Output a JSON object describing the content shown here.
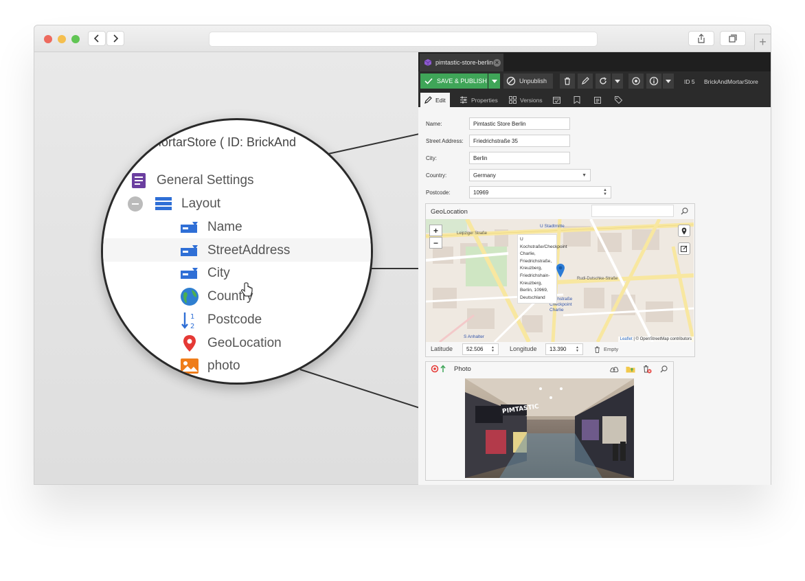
{
  "browser": {
    "title": ""
  },
  "magnifier": {
    "header": "dMortarStore ( ID: BrickAnd",
    "items": [
      {
        "label": "General Settings",
        "icon": "document-list-icon"
      },
      {
        "label": "Layout",
        "icon": "layout-panel-icon"
      },
      {
        "label": "Name",
        "icon": "input-field-icon"
      },
      {
        "label": "StreetAddress",
        "icon": "input-field-icon"
      },
      {
        "label": "City",
        "icon": "input-field-icon"
      },
      {
        "label": "Country",
        "icon": "globe-icon"
      },
      {
        "label": "Postcode",
        "icon": "number-sort-icon"
      },
      {
        "label": "GeoLocation",
        "icon": "map-pin-icon"
      },
      {
        "label": "photo",
        "icon": "image-icon"
      }
    ]
  },
  "pimcore": {
    "tab": {
      "label": "pimtastic-store-berlin"
    },
    "toolbar": {
      "save_label": "SAVE & PUBLISH",
      "unpublish_label": "Unpublish",
      "id_label": "ID 5",
      "class_label": "BrickAndMortarStore"
    },
    "subtabs": {
      "edit": "Edit",
      "properties": "Properties",
      "versions": "Versions"
    },
    "form": {
      "name_label": "Name:",
      "name_value": "Pimtastic Store Berlin",
      "street_label": "Street Address:",
      "street_value": "Friedrichstraße 35",
      "city_label": "City:",
      "city_value": "Berlin",
      "country_label": "Country:",
      "country_value": "Germany",
      "postcode_label": "Postcode:",
      "postcode_value": "10969"
    },
    "geo": {
      "title": "GeoLocation",
      "tooltip": "U Kochstraße/Checkpoint Charlie, Friedrichstraße, Kreuzberg, Friedrichshain-Kreuzberg, Berlin, 10969, Deutschland",
      "attribution_leaflet": "Leaflet",
      "attribution_rest": "| © OpenStreetMap contributors",
      "latitude_label": "Latitude",
      "latitude_value": "52.506",
      "longitude_label": "Longitude",
      "longitude_value": "13.390",
      "empty_label": "Empty",
      "map_labels": {
        "u_stadtmitte": "U Stadtmitte",
        "leipziger": "Leipziger Straße",
        "rudi_dutschke": "Rudi-Dutschke-Straße",
        "kochstrasse": "Kochstraße Checkpoint Charlie",
        "anhalter": "S Anhalter"
      }
    },
    "photo": {
      "title": "Photo",
      "sign_text": "PIMTASTIC"
    }
  },
  "colors": {
    "save_green": "#3fa558",
    "dark_toolbar": "#2b2b2b",
    "lens_purple": "#6b3fa0",
    "lens_blue": "#2f6fd6",
    "map_pin": "#2b7bd6"
  }
}
